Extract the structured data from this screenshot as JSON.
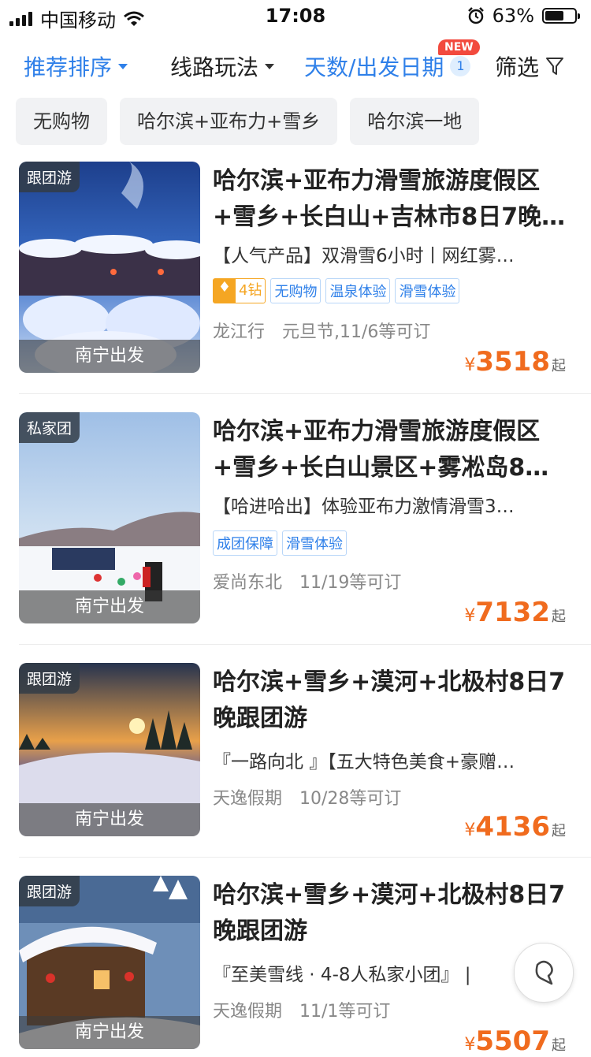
{
  "status": {
    "carrier": "中国移动",
    "time": "17:08",
    "battery_text": "63%",
    "battery_level": 0.63
  },
  "filters": [
    {
      "label": "推荐排序",
      "active": true
    },
    {
      "label": "线路玩法",
      "active": false
    },
    {
      "label": "天数/出发日期",
      "active": true,
      "badge": "NEW",
      "count": "1"
    },
    {
      "label": "筛选",
      "active": false
    }
  ],
  "chips": [
    "无购物",
    "哈尔滨+亚布力+雪乡",
    "哈尔滨一地"
  ],
  "products": [
    {
      "tag": "跟团游",
      "depart": "南宁出发",
      "title": "哈尔滨+亚布力滑雪旅游度假区+雪乡+长白山+吉林市8日7晚…",
      "desc": "【人气产品】双滑雪6小时丨网红雾…",
      "diamond": "4钻",
      "tags": [
        "无购物",
        "温泉体验",
        "滑雪体验"
      ],
      "seller": "龙江行",
      "date": "元旦节,11/6等可订",
      "currency": "¥",
      "price": "3518",
      "suffix": "起"
    },
    {
      "tag": "私家团",
      "depart": "南宁出发",
      "title": "哈尔滨+亚布力滑雪旅游度假区+雪乡+长白山景区+雾凇岛8…",
      "desc": "【哈进哈出】体验亚布力激情滑雪3…",
      "tags": [
        "成团保障",
        "滑雪体验"
      ],
      "seller": "爱尚东北",
      "date": "11/19等可订",
      "currency": "¥",
      "price": "7132",
      "suffix": "起"
    },
    {
      "tag": "跟团游",
      "depart": "南宁出发",
      "title": "哈尔滨+雪乡+漠河+北极村8日7晚跟团游",
      "desc": "『一路向北 』【五大特色美食+豪赠…",
      "seller": "天逸假期",
      "date": "10/28等可订",
      "currency": "¥",
      "price": "4136",
      "suffix": "起"
    },
    {
      "tag": "跟团游",
      "depart": "南宁出发",
      "title": "哈尔滨+雪乡+漠河+北极村8日7晚跟团游",
      "desc": "『至美雪线 · 4-8人私家小团』 |",
      "seller": "天逸假期",
      "date": "11/1等可订",
      "currency": "¥",
      "price": "5507",
      "suffix": "起"
    }
  ],
  "colors": {
    "accent": "#2f80e9",
    "price": "#f06b1e",
    "new_badge": "#f24a3e"
  },
  "icons": {
    "filter": "funnel-icon",
    "float": "customer-service-icon"
  }
}
